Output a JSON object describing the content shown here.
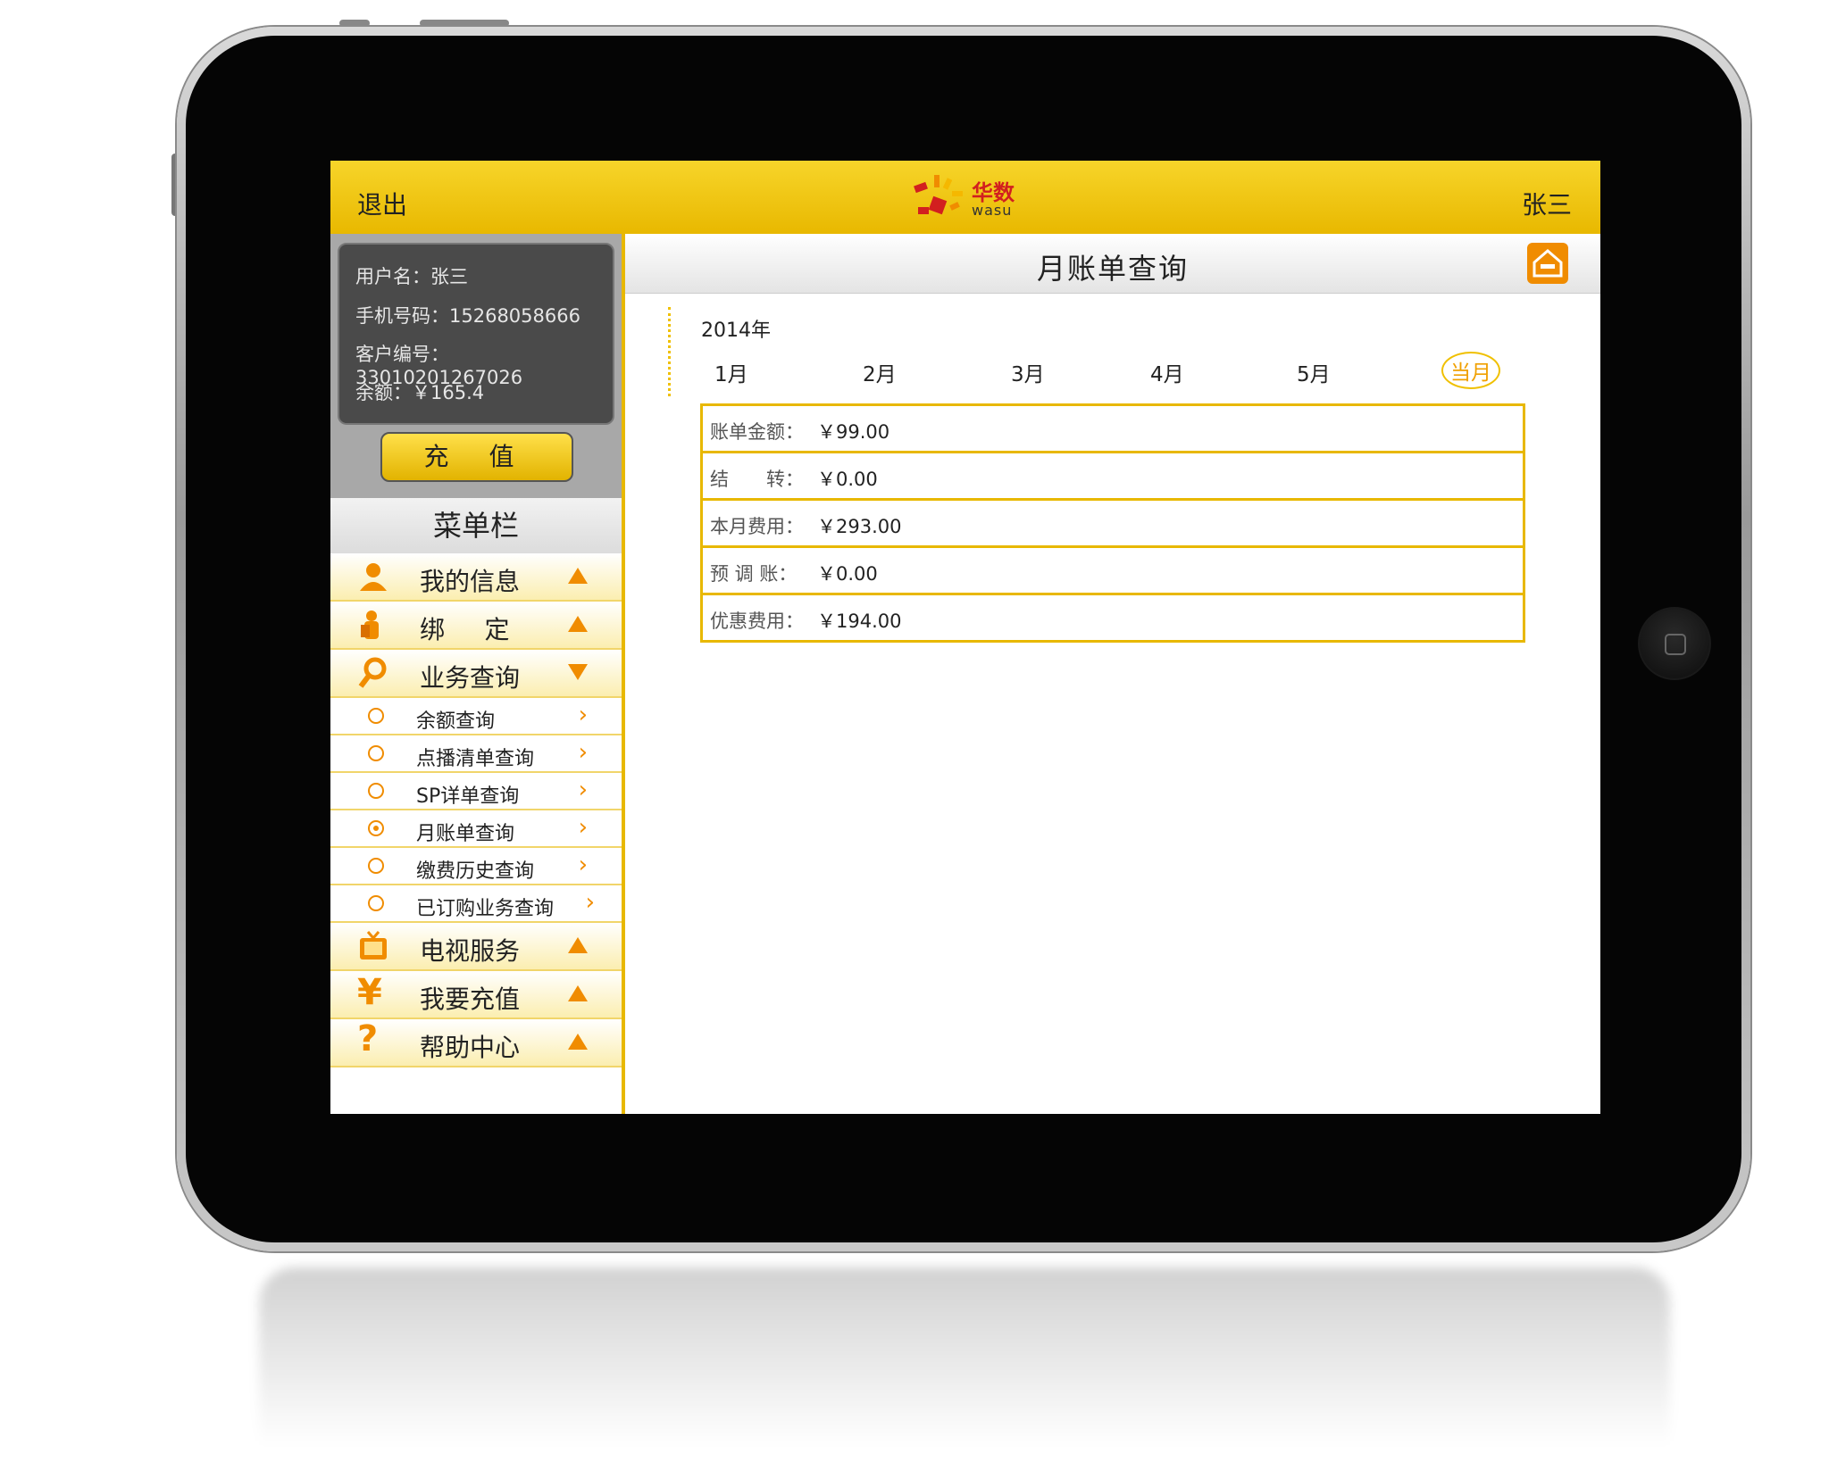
{
  "header": {
    "exit_label": "退出",
    "username": "张三",
    "logo_cn": "华数",
    "logo_en": "wasu"
  },
  "account": {
    "user_line": "用户名：张三",
    "phone_line": "手机号码：15268058666",
    "customer_line": "客户编号：33010201267026",
    "balance_line": "余额：￥165.4",
    "recharge_label": "充 值"
  },
  "menu": {
    "title": "菜单栏",
    "items": [
      {
        "label": "我的信息",
        "icon": "user-icon",
        "state": "collapsed"
      },
      {
        "label": "绑     定",
        "icon": "bind-icon",
        "state": "collapsed"
      },
      {
        "label": "业务查询",
        "icon": "search-icon",
        "state": "expanded"
      },
      {
        "label": "电视服务",
        "icon": "tv-icon",
        "state": "collapsed"
      },
      {
        "label": "我要充值",
        "icon": "yen-icon",
        "state": "collapsed"
      },
      {
        "label": "帮助中心",
        "icon": "help-icon",
        "state": "collapsed"
      }
    ],
    "subitems": [
      {
        "label": "余额查询",
        "selected": false
      },
      {
        "label": "点播清单查询",
        "selected": false
      },
      {
        "label": "SP详单查询",
        "selected": false
      },
      {
        "label": "月账单查询",
        "selected": true
      },
      {
        "label": "缴费历史查询",
        "selected": false
      },
      {
        "label": "已订购业务查询",
        "selected": false
      }
    ]
  },
  "main": {
    "title": "月账单查询",
    "year": "2014年",
    "months": [
      "1月",
      "2月",
      "3月",
      "4月",
      "5月",
      "当月"
    ],
    "selected_month": "当月",
    "bill_rows": [
      {
        "key": "账单金额：",
        "value": "￥99.00"
      },
      {
        "key": "结　　转：",
        "value": "￥0.00"
      },
      {
        "key": "本月费用：",
        "value": "￥293.00"
      },
      {
        "key": "预 调 账：",
        "value": "￥0.00"
      },
      {
        "key": "优惠费用：",
        "value": "￥194.00"
      }
    ]
  },
  "colors": {
    "accent": "#e8b800",
    "orange": "#f08c00",
    "bezel": "#050505"
  }
}
